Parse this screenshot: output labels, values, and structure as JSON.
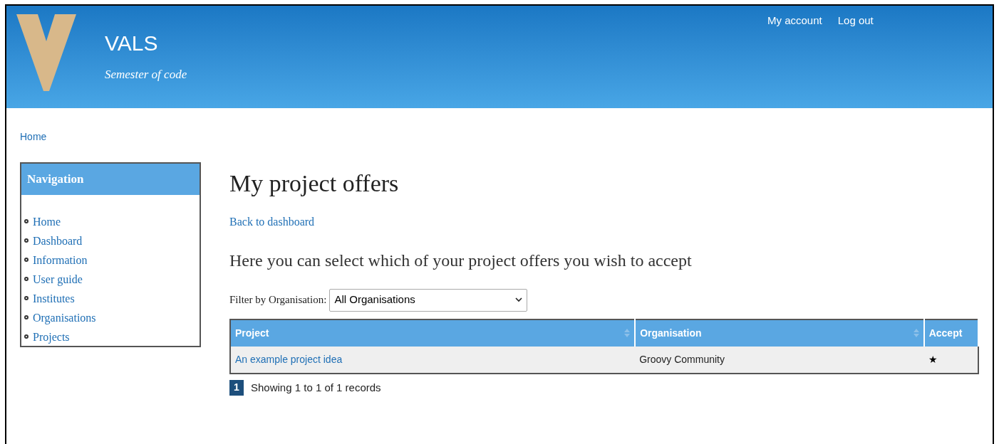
{
  "header": {
    "site_name": "VALS",
    "tagline": "Semester of code",
    "links": [
      "My account",
      "Log out"
    ]
  },
  "breadcrumb": [
    "Home"
  ],
  "navigation": {
    "title": "Navigation",
    "items": [
      "Home",
      "Dashboard",
      "Information",
      "User guide",
      "Institutes",
      "Organisations",
      "Projects"
    ]
  },
  "main": {
    "title": "My project offers",
    "back_link": "Back to dashboard",
    "subtitle": "Here you can select which of your project offers you wish to accept",
    "filter": {
      "label": "Filter by Organisation:",
      "value": "All Organisations"
    },
    "table": {
      "columns": [
        {
          "label": "Project",
          "sortable": true
        },
        {
          "label": "Organisation",
          "sortable": true
        },
        {
          "label": "Accept",
          "sortable": false
        }
      ],
      "rows": [
        {
          "project": "An example project idea",
          "organisation": "Groovy Community",
          "accept": "★"
        }
      ]
    },
    "pagination": {
      "pages": [
        {
          "label": "1",
          "selected": true
        }
      ],
      "info": "Showing 1 to 1 of 1 records"
    }
  }
}
